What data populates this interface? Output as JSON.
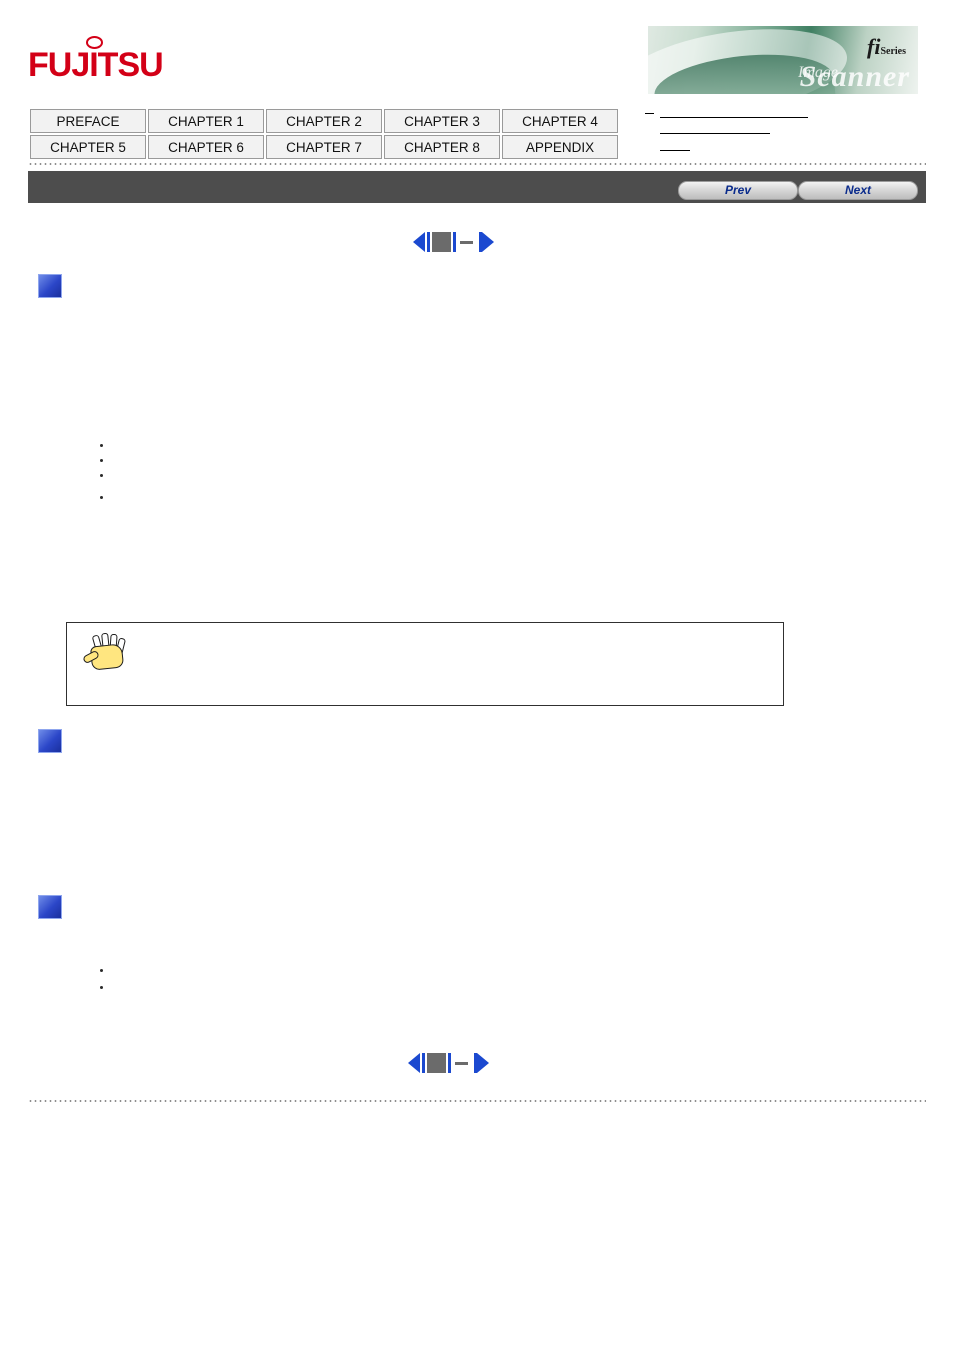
{
  "brand": {
    "logo_text": "FUJITSU",
    "banner_fi": "fi",
    "banner_series": "Series",
    "banner_scanner": "Scanner",
    "banner_image": "Image"
  },
  "chapter_nav": {
    "row1": [
      "PREFACE",
      "CHAPTER 1",
      "CHAPTER 2",
      "CHAPTER 3",
      "CHAPTER 4"
    ],
    "row2": [
      "CHAPTER 5",
      "CHAPTER 6",
      "CHAPTER 7",
      "CHAPTER 8",
      "APPENDIX"
    ]
  },
  "toolbar": {
    "prev_label": "Prev",
    "next_label": "Next"
  },
  "pager": {
    "first_icon": "first-page-icon",
    "prev_icon": "previous-page-icon",
    "current_icon": "current-page-indicator",
    "separator_icon": "page-separator-dash",
    "next_icon": "next-page-icon"
  },
  "content": {
    "section_icons": [
      "section-marker-blue-1",
      "section-marker-blue-2",
      "section-marker-blue-3"
    ],
    "bullets_group1": [
      "bullet-1",
      "bullet-2",
      "bullet-3",
      "bullet-4"
    ],
    "bullets_group2": [
      "bullet-5",
      "bullet-6"
    ],
    "caution": {
      "icon": "caution-hand-icon",
      "text": ""
    },
    "section1_text": "",
    "section2_text": "",
    "section3_text": ""
  }
}
